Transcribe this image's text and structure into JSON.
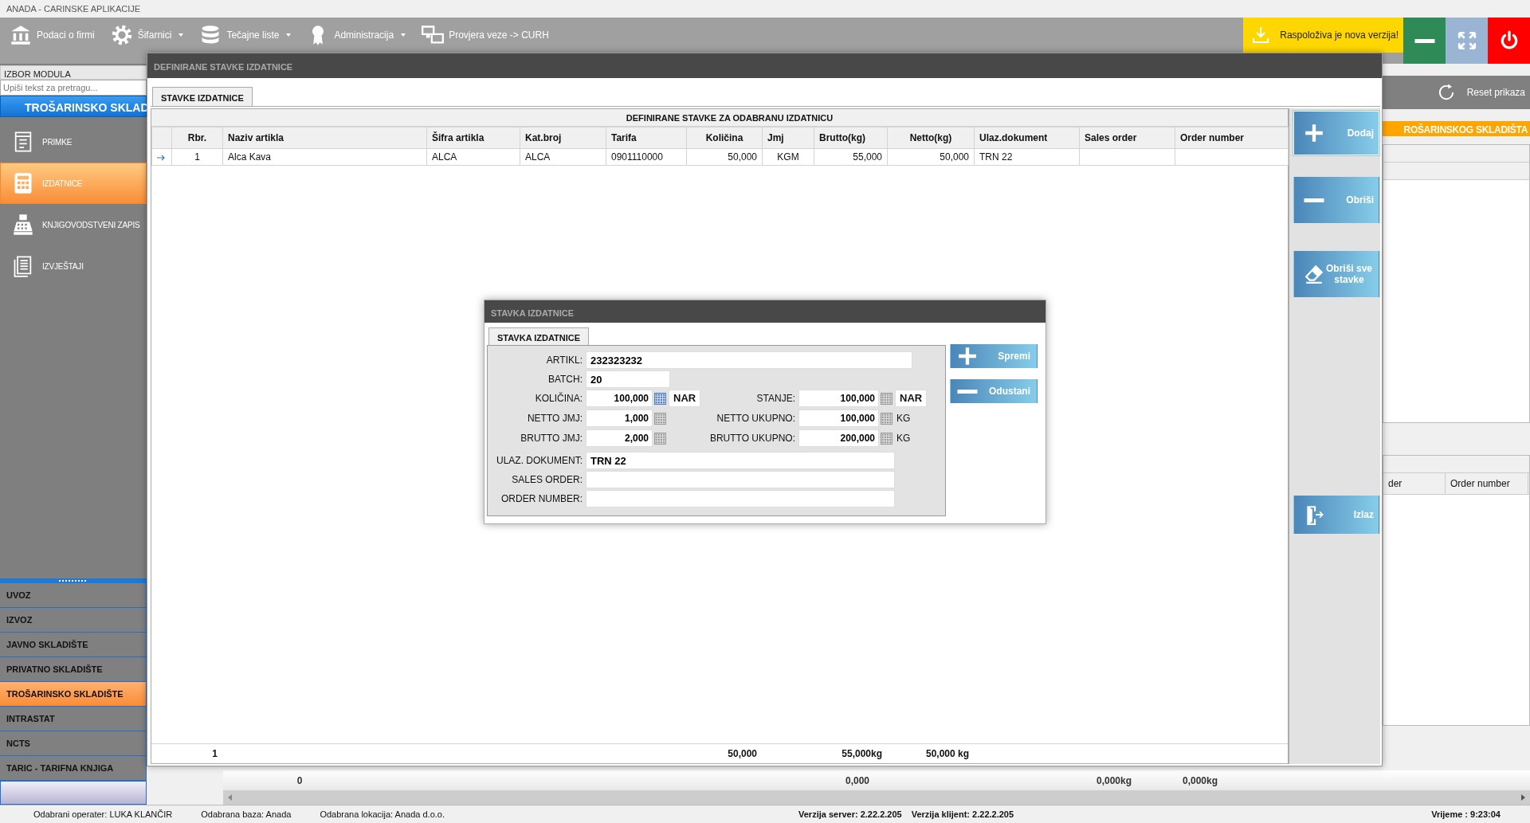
{
  "app_title": "ANADA - CARINSKE APLIKACIJE",
  "toolbar": {
    "items": [
      {
        "label": "Podaci o firmi",
        "kind": "bank",
        "has_menu": false
      },
      {
        "label": "Šifarnici",
        "kind": "gear",
        "has_menu": true
      },
      {
        "label": "Tečajne liste",
        "kind": "database",
        "has_menu": true
      },
      {
        "label": "Administracija",
        "kind": "award",
        "has_menu": true
      },
      {
        "label": "Provjera veze -> CURH",
        "kind": "monitors",
        "has_menu": false
      }
    ],
    "update_notice": "Raspoloživa je nova verzija!"
  },
  "sidebar": {
    "header": "IZBOR MODULA",
    "search_placeholder": "Upiši tekst za pretragu...",
    "group_title": "TROŠARINSKO SKLAD",
    "items": [
      {
        "label": "PRIMKE",
        "kind": "receipt",
        "selected": false
      },
      {
        "label": "IZDATNICE",
        "kind": "calculator",
        "selected": true
      },
      {
        "label": "KNJIGOVODSTVENI ZAPIS",
        "kind": "register",
        "selected": false
      },
      {
        "label": "IZVJEŠTAJI",
        "kind": "reports",
        "selected": false
      }
    ],
    "modules": [
      {
        "label": "UVOZ",
        "selected": false
      },
      {
        "label": "IZVOZ",
        "selected": false
      },
      {
        "label": "JAVNO SKLADIŠTE",
        "selected": false
      },
      {
        "label": "PRIVATNO SKLADIŠTE",
        "selected": false
      },
      {
        "label": "TROŠARINSKO SKLADIŠTE",
        "selected": true
      },
      {
        "label": "INTRASTAT",
        "selected": false
      },
      {
        "label": "NCTS",
        "selected": false
      },
      {
        "label": "TARIC - TARIFNA KNJIGA",
        "selected": false
      }
    ]
  },
  "background": {
    "reset_label": "Reset prikaza",
    "section_title": "ROŠARINSKOG SKLADIŠTA",
    "lower_columns": [
      "der",
      "Order number"
    ],
    "totals": [
      "0",
      "0,000",
      "0,000kg",
      "0,000kg"
    ]
  },
  "stavke_window": {
    "title": "DEFINIRANE STAVKE IZDATNICE",
    "tabs": [
      {
        "label": "STAVKE IZDATNICE",
        "selected": true
      }
    ],
    "grid_title": "DEFINIRANE STAVKE ZA ODABRANU IZDATNICU",
    "columns": [
      "Rbr.",
      "Naziv artikla",
      "Šifra artikla",
      "Kat.broj",
      "Tarifa",
      "Količina",
      "Jmj",
      "Brutto(kg)",
      "Netto(kg)",
      "Ulaz.dokument",
      "Sales order",
      "Order number"
    ],
    "rows": [
      {
        "current": true,
        "cells": [
          "1",
          "Alca Kava",
          "ALCA",
          "ALCA",
          "0901110000",
          "50,000",
          "KGM",
          "55,000",
          "50,000",
          "TRN 22"
        ]
      }
    ],
    "totals": {
      "rbr": "1",
      "kolicina": "50,000",
      "brutto": "55,000kg",
      "netto": "50,000 kg"
    },
    "buttons": [
      {
        "label": "Dodaj",
        "kind": "add",
        "focused": true
      },
      {
        "label": "Obriši",
        "kind": "remove",
        "focused": false
      },
      {
        "label": "Obriši sve stavke",
        "kind": "clear",
        "focused": false
      },
      {
        "label": "Izlaz",
        "kind": "exit",
        "focused": false
      }
    ]
  },
  "dialog": {
    "title": "STAVKA IZDATNICE",
    "tabs": [
      {
        "label": "STAVKA IZDATNICE",
        "selected": true
      }
    ],
    "rows": [
      {
        "kind": "wide",
        "label": "ARTIKL:",
        "value": "232323232"
      },
      {
        "kind": "short",
        "label": "BATCH:",
        "value": "20"
      },
      {
        "kind": "pair",
        "left": {
          "label": "KOLIČINA:",
          "value": "100,000",
          "unit": "NAR",
          "unit_boxed": true,
          "active": true
        },
        "right": {
          "label": "STANJE:",
          "value": "100,000",
          "unit": "NAR",
          "unit_boxed": true,
          "active": false
        }
      },
      {
        "kind": "pair",
        "left": {
          "label": "NETTO JMJ:",
          "value": "1,000",
          "active": false
        },
        "right": {
          "label": "NETTO UKUPNO:",
          "value": "100,000",
          "unit": "KG",
          "unit_boxed": false,
          "active": false
        }
      },
      {
        "kind": "pair",
        "left": {
          "label": "BRUTTO JMJ:",
          "value": "2,000",
          "active": false
        },
        "right": {
          "label": "BRUTTO UKUPNO:",
          "value": "200,000",
          "unit": "KG",
          "unit_boxed": false,
          "active": false
        }
      },
      {
        "kind": "doc",
        "label": "ULAZ. DOKUMENT:",
        "value": "TRN 22"
      },
      {
        "kind": "doc",
        "label": "SALES ORDER:"
      },
      {
        "kind": "doc",
        "label": "ORDER NUMBER:"
      }
    ],
    "buttons": [
      {
        "label": "Spremi",
        "kind": "add"
      },
      {
        "label": "Odustani",
        "kind": "remove"
      }
    ]
  },
  "status_bar": {
    "left": [
      "Odabrani operater: LUKA KLANČIR",
      "Odabrana baza: Anada",
      "Odabrana lokacija: Anada d.o.o."
    ],
    "center": [
      "Verzija server: 2.22.2.205",
      "Verzija klijent: 2.22.2.205"
    ],
    "right": "Vrijeme : 9:23:04"
  }
}
